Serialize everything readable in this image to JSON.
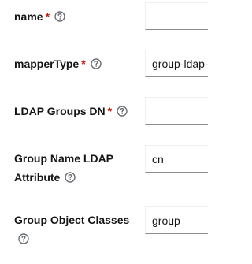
{
  "fields": [
    {
      "label": "name",
      "required": "*",
      "value": ""
    },
    {
      "label": "mapperType",
      "required": "*",
      "value": "group-ldap-mapper"
    },
    {
      "label": "LDAP Groups DN",
      "required": "*",
      "value": ""
    },
    {
      "label_line1": "Group Name LDAP",
      "label_line2": "Attribute",
      "value": "cn"
    },
    {
      "label": "Group Object Classes",
      "value": "group"
    }
  ],
  "icons": {
    "help": "help-circle-icon"
  },
  "colors": {
    "required": "#c9190b",
    "input_border_bottom": "#8a8d90",
    "help_icon": "#6a6e73"
  }
}
